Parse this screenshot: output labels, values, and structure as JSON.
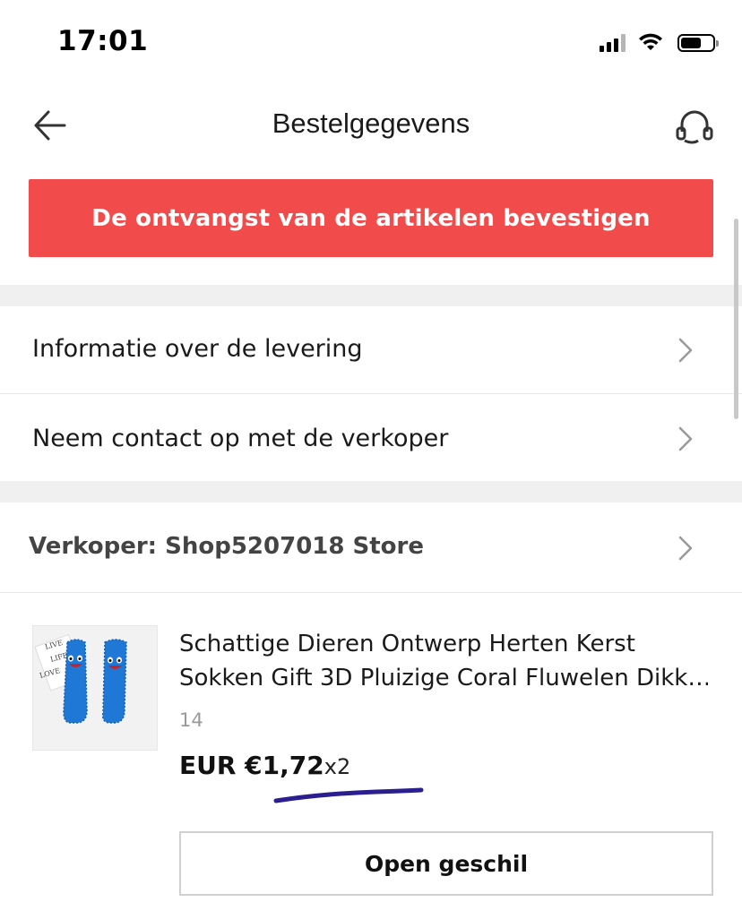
{
  "status_bar": {
    "time": "17:01"
  },
  "header": {
    "title": "Bestelgegevens",
    "back_icon": "arrow-left-icon",
    "support_icon": "headset-icon"
  },
  "confirm_button": {
    "label": "De ontvangst van de artikelen bevestigen",
    "color": "#f24b4b"
  },
  "menu": {
    "items": [
      {
        "label": "Informatie over de levering"
      },
      {
        "label": "Neem contact op met de verkoper"
      }
    ]
  },
  "seller": {
    "label": "Verkoper: Shop5207018 Store"
  },
  "product": {
    "title_line1": "Schattige Dieren Ontwerp Herten Kerst",
    "title_line2": "Sokken Gift 3D Pluizige Coral Fluwelen Dikk…",
    "variant": "14",
    "price": "EUR €1,72",
    "quantity": "x2",
    "dispute_button": "Open geschil",
    "image_text": [
      "LIVE",
      "LIFE",
      "LOVE"
    ]
  }
}
